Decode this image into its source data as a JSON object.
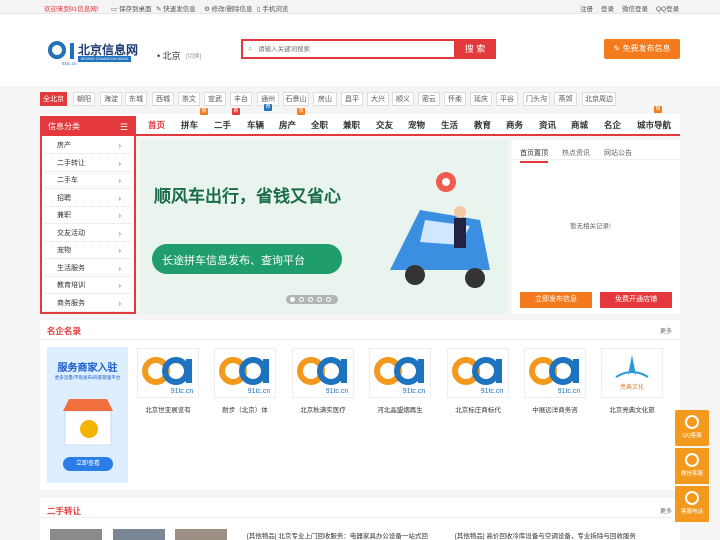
{
  "topbar": {
    "welcome": "欢迎来到91信息网!",
    "links": [
      "保存到桌面",
      "快速发信息",
      "修改/删除信息",
      "手机浏览"
    ],
    "right_links": [
      "注册",
      "登录",
      "微信登录",
      "QQ登录"
    ]
  },
  "header": {
    "logo_text": "北京信息网",
    "logo_sub": "91tc.cn",
    "logo_pinyin": "BEIJING CHUANGXIN WANG",
    "city": "北京",
    "switch": "[切换]",
    "search_placeholder": "请输入关键词搜索",
    "search_button": "搜 索",
    "publish_button": "免费发布信息"
  },
  "cities": [
    "全北京",
    "朝阳",
    "海淀",
    "东城",
    "西城",
    "崇文",
    "宣武",
    "丰台",
    "通州",
    "石景山",
    "房山",
    "昌平",
    "大兴",
    "顺义",
    "密云",
    "怀柔",
    "延庆",
    "平谷",
    "门头沟",
    "燕郊",
    "北京周边"
  ],
  "sidebar": {
    "title": "信息分类",
    "items": [
      "房产",
      "二手转让",
      "二手车",
      "招聘",
      "兼职",
      "交友活动",
      "宠物",
      "生活服务",
      "教育培训",
      "商务服务"
    ]
  },
  "nav": {
    "items": [
      "首页",
      "拼车",
      "二手",
      "车辆",
      "房产",
      "全职",
      "兼职",
      "交友",
      "宠物",
      "生活",
      "教育",
      "商务",
      "资讯",
      "商城",
      "名企",
      "城市导航"
    ],
    "badges": {
      "hot": "热",
      "new": "新",
      "rec": "荐"
    }
  },
  "banner": {
    "headline": "顺风车出行，省钱又省心",
    "subline": "长途拼车信息发布、查询平台"
  },
  "notice": {
    "tabs": [
      "首页置顶",
      "热点资讯",
      "网站公告"
    ],
    "empty": "暂无相关记录!",
    "btn_publish": "立即发布信息",
    "btn_store": "免费开通店铺"
  },
  "famous": {
    "title": "名企名录",
    "more": "更多",
    "promo_title": "服务商家入驻",
    "promo_sub": "更多流量/不限发布/商家管理平台",
    "promo_btn": "立即查看",
    "logo_text": "91tc.cn",
    "education_logo_text": "亮典文化",
    "companies": [
      "北京世亚展览有",
      "耐步（北京）体",
      "北京秋满实医疗",
      "河北晶盟烟再生",
      "北京标庄商标代",
      "中展远洋商务咨",
      "北京亮典文化旅"
    ]
  },
  "secondhand": {
    "title": "二手转让",
    "more": "更多",
    "items": [
      "[其他物品] 北京专业上门回收服务：电器家具办公设备一站式回",
      "[其他物品] 高价回收冷库设备与空调设备，专业拆除与回收服务"
    ]
  },
  "float": [
    "QQ客服",
    "微信客服",
    "客服电话"
  ]
}
